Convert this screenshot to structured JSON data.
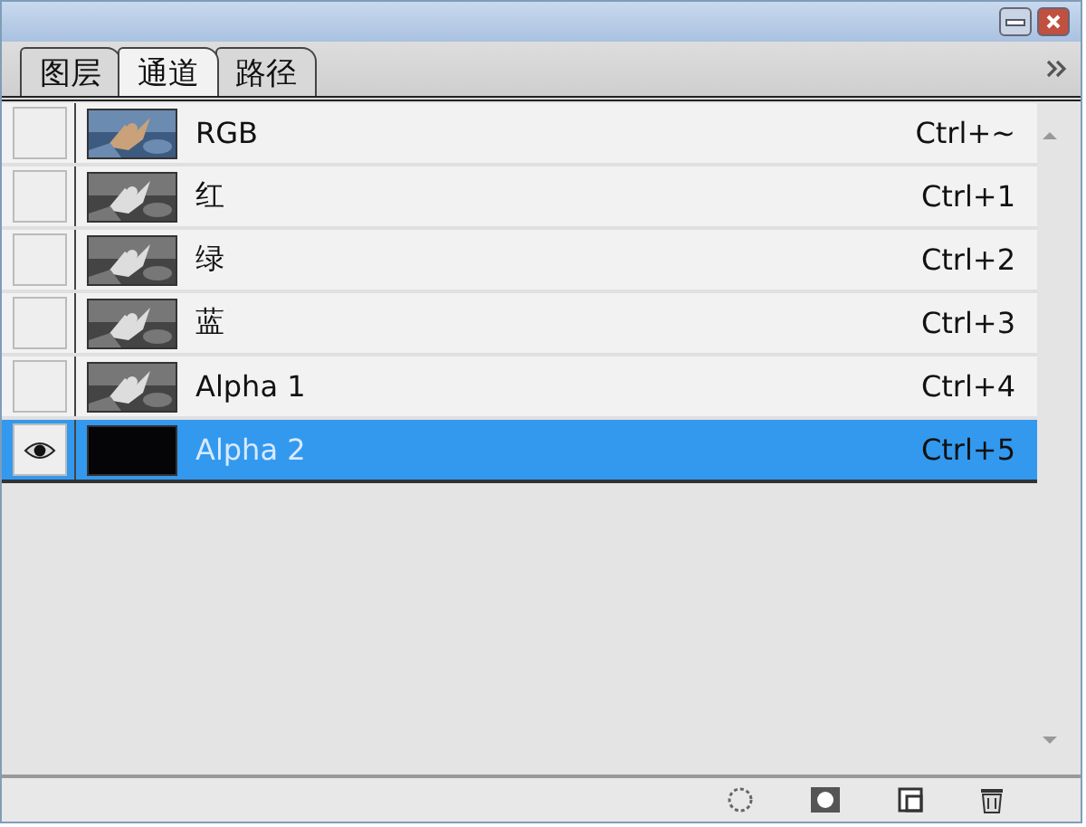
{
  "tabs": [
    {
      "label": "图层",
      "selected": false
    },
    {
      "label": "通道",
      "selected": true
    },
    {
      "label": "路径",
      "selected": false
    }
  ],
  "channels": [
    {
      "name": "RGB",
      "shortcut": "Ctrl+~",
      "kind": "color",
      "visible": false,
      "selected": false
    },
    {
      "name": "红",
      "shortcut": "Ctrl+1",
      "kind": "grayscale",
      "visible": false,
      "selected": false
    },
    {
      "name": "绿",
      "shortcut": "Ctrl+2",
      "kind": "grayscale",
      "visible": false,
      "selected": false
    },
    {
      "name": "蓝",
      "shortcut": "Ctrl+3",
      "kind": "grayscale",
      "visible": false,
      "selected": false
    },
    {
      "name": "Alpha 1",
      "shortcut": "Ctrl+4",
      "kind": "grayscale",
      "visible": false,
      "selected": false
    },
    {
      "name": "Alpha 2",
      "shortcut": "Ctrl+5",
      "kind": "mask",
      "visible": true,
      "selected": true
    }
  ]
}
